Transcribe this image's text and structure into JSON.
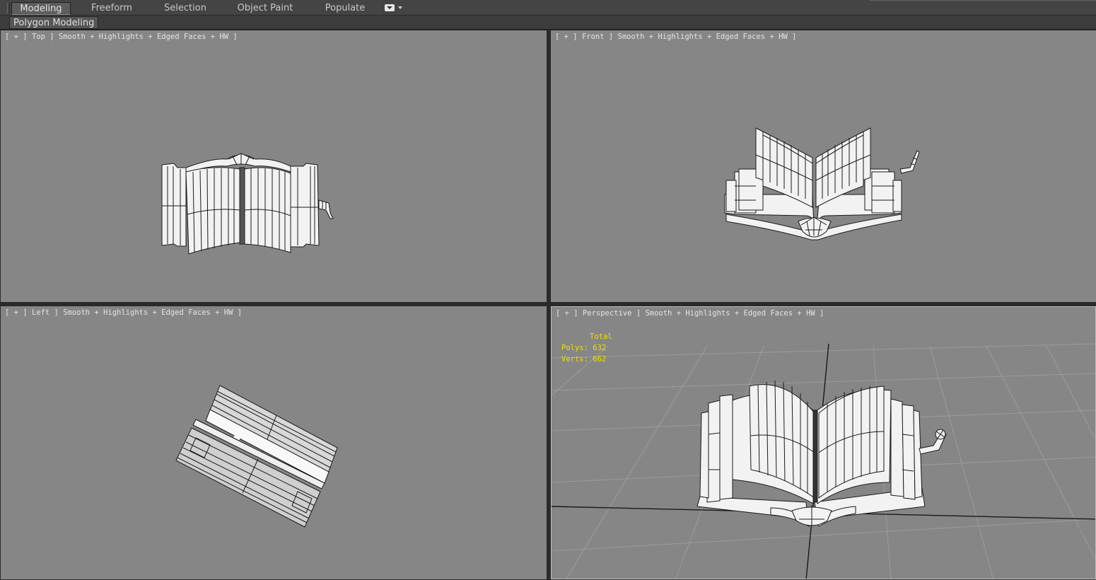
{
  "ribbon": {
    "tabs": [
      "Modeling",
      "Freeform",
      "Selection",
      "Object Paint",
      "Populate"
    ],
    "active_tab": "Modeling",
    "subtab": "Polygon Modeling"
  },
  "viewports": {
    "top": {
      "pre": "[ + ] ",
      "view": "Top",
      "shading": " ] Smooth + Highlights + Edged Faces + HW ]"
    },
    "front": {
      "pre": "[ + ] ",
      "view": "Front",
      "shading": " ] Smooth + Highlights + Edged Faces + HW ]"
    },
    "left": {
      "pre": "[ + ] ",
      "view": "Left",
      "shading": " ] Smooth + Highlights + Edged Faces + HW ]"
    },
    "persp": {
      "pre": "[ + ] ",
      "view": "Perspective",
      "shading": " ] Smooth + Highlights + Edged Faces + HW ]"
    }
  },
  "stats": {
    "header": "Total",
    "polys_label": "Polys:",
    "polys": "632",
    "verts_label": "Verts:",
    "verts": "662"
  },
  "colors": {
    "viewport_bg": "#868686",
    "stats_text": "#f0e000",
    "mesh_face": "#f2f2f2",
    "mesh_wire": "#1a1a1a"
  }
}
